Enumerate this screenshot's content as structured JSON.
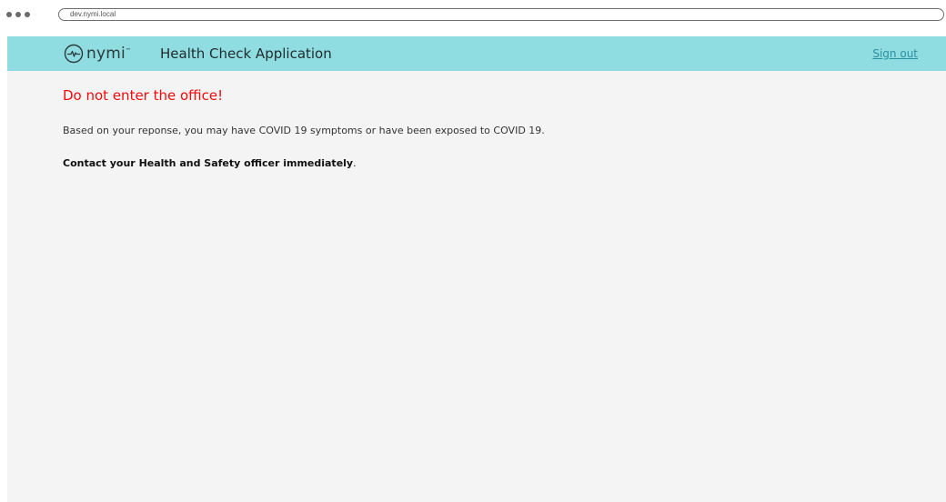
{
  "browser": {
    "url": "dev.nymi.local"
  },
  "header": {
    "logo_text": "nymi",
    "logo_tm": "™",
    "app_title": "Health Check Application",
    "signout_label": "Sign out",
    "background_color": "#8fdde0"
  },
  "main": {
    "warning": "Do not enter the office!",
    "warning_color": "#f50a0a",
    "message": "Based on your reponse, you may have COVID 19 symptoms or have been exposed to COVID 19.",
    "instruction_bold": "Contact your Health and Safety officer immediately",
    "instruction_suffix": "."
  }
}
